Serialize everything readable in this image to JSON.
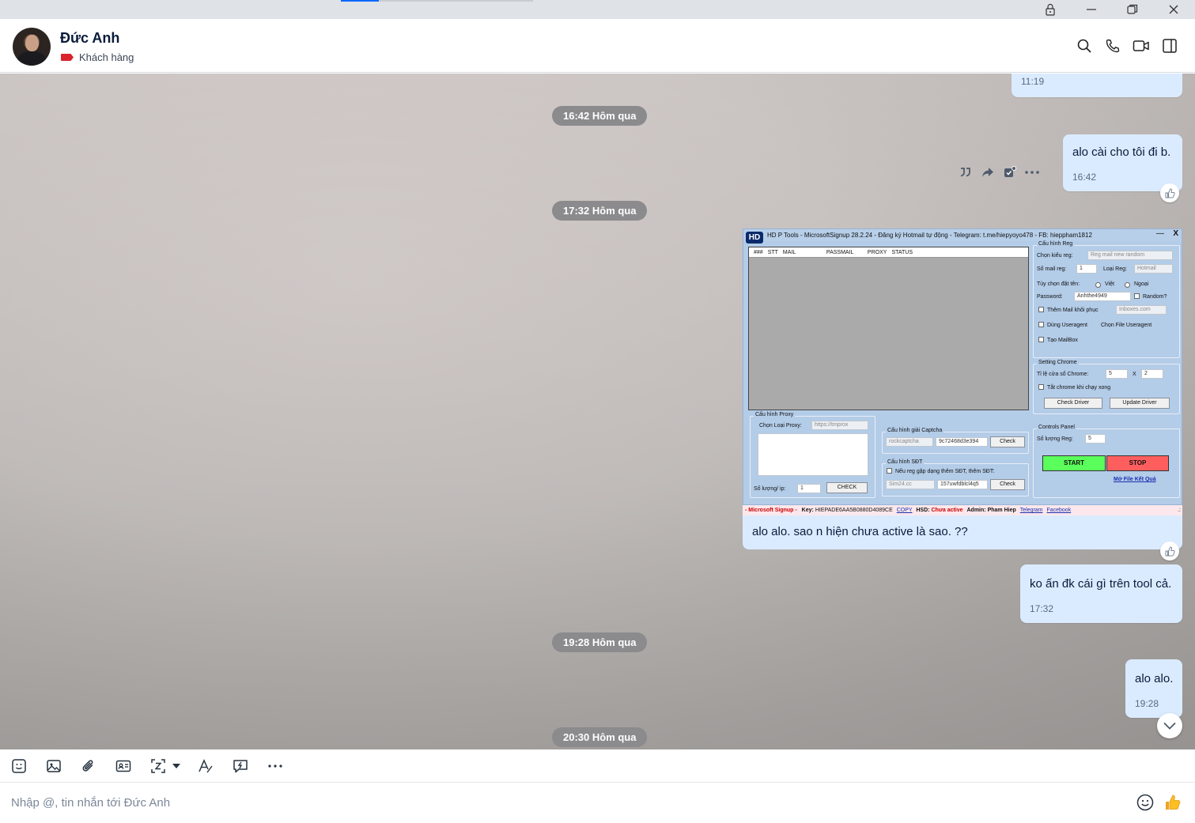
{
  "header": {
    "contact_name": "Đức Anh",
    "tag_label": "Khách hàng",
    "tag_color": "#d9232d"
  },
  "window_controls": [
    "lock-icon",
    "minimize-icon",
    "restore-icon",
    "close-icon"
  ],
  "header_actions": [
    "search-icon",
    "phone-icon",
    "video-call-icon",
    "sidebar-toggle-icon"
  ],
  "chat": {
    "partial_bubble_time": "11:19",
    "separators": [
      "16:42 Hôm qua",
      "17:32 Hôm qua",
      "19:28 Hôm qua",
      "20:30 Hôm qua"
    ],
    "messages": [
      {
        "text": "alo cài cho tôi đi b.",
        "time": "16:42"
      },
      {
        "text": "alo alo. sao n hiện chưa active là sao. ??"
      },
      {
        "text": "ko ấn đk cái gì trên tool cả.",
        "time": "17:32"
      },
      {
        "text": "alo alo.",
        "time": "19:28"
      }
    ],
    "hover_actions": [
      "quote-icon",
      "forward-icon",
      "edit-todo-icon",
      "more-icon"
    ]
  },
  "screenshot": {
    "title": "HD   P Tools - MicrosoftSignup 28.2.24 - Đăng ký Hotmail tự động - Telegram: t.me/hiepyoyo478 - FB: hieppham1812",
    "logo": "HD",
    "close": "X",
    "minimize": "—",
    "grid_columns": [
      "###",
      "STT",
      "MAIL",
      "PASSMAIL",
      "PROXY",
      "STATUS"
    ],
    "reg": {
      "group": "Cấu hình Reg",
      "type_label": "Chọn kiểu reg:",
      "type_value": "Reg mail new random",
      "count_label": "Số mail reg:",
      "count_value": "1",
      "kind_label": "Loại Reg:",
      "kind_value": "Hotmail",
      "name_label": "Tùy chọn đặt tên:",
      "name_opt1": "Việt",
      "name_opt2": "Ngoại",
      "password_label": "Password:",
      "password_value": "Anhthe4949",
      "random_label": "Random?",
      "recover_label": "Thêm Mail khôi phục",
      "recover_value": "Inboxes.com",
      "ua_label": "Dùng Useragent",
      "ua_file": "Chọn File Useragent",
      "mailbox_label": "Tạo MailBox"
    },
    "chrome": {
      "group": "Setting Chrome",
      "ratio_label": "Tỉ lệ cửa sổ Chrome:",
      "ratio_a": "5",
      "ratio_x": "X",
      "ratio_b": "2",
      "close_label": "Tắt chrome khi chạy xong",
      "check_driver": "Check Driver",
      "update_driver": "Update Driver"
    },
    "proxy": {
      "group": "Cấu hình Proxy",
      "type_label": "Chọn Loại Proxy:",
      "type_value": "https://tmprox",
      "per_ip_label": "Số lượng/ ip:",
      "per_ip_value": "1",
      "check": "CHECK"
    },
    "captcha": {
      "group": "Cấu hình giải Captcha",
      "provider": "rockcaptcha",
      "key": "9c72468d3e394",
      "check": "Check"
    },
    "phone": {
      "group": "Cấu hình SĐT",
      "label": "Nếu reg gặp dạng thêm SĐT, thêm SĐT:",
      "provider": "Sim24.cc",
      "key": "157uwfdblcl4q5",
      "check": "Check"
    },
    "controls": {
      "group": "Controls Panel",
      "count_label": "Số lượng Reg:",
      "count_value": "5",
      "start": "START",
      "stop": "STOP",
      "open_result": "Mở File Kết Quả"
    },
    "status_bar": {
      "app": "- Microsoft Signup -",
      "key_label": "Key:",
      "key_value": "HIEPADE6AA5B0880D4089CE",
      "copy": "COPY",
      "hsd_label": "HSD:",
      "hsd_value": "Chưa active",
      "admin_label": "Admin:",
      "admin_value": "Pham Hiep",
      "telegram": "Telegram",
      "facebook": "Facebook",
      "grip": ".:"
    }
  },
  "toolbar": [
    "sticker-icon",
    "image-icon",
    "attach-icon",
    "contact-card-icon",
    "screenshot-icon",
    "dropdown-icon",
    "text-format-icon",
    "quick-message-icon",
    "more-icon"
  ],
  "composer": {
    "placeholder": "Nhập @, tin nhắn tới Đức Anh",
    "emoji": "emoji-icon",
    "like": "thumbs-up-icon"
  },
  "colors": {
    "bubble": "#dbebff",
    "pill": "#8b8a8c",
    "start": "#5bff5b",
    "stop": "#ff5e5e",
    "accent": "#0068ff"
  }
}
